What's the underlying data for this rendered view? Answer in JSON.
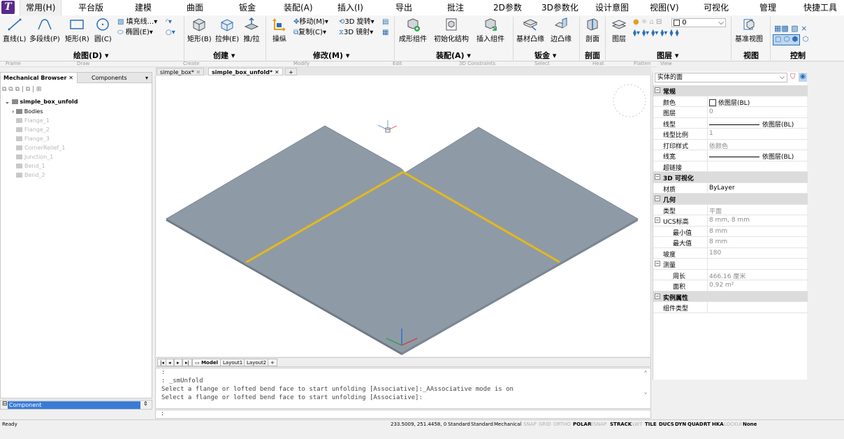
{
  "menu": {
    "tabs": [
      {
        "label": "常用(H)",
        "active": true
      },
      {
        "label": "平台版"
      },
      {
        "label": "建模"
      },
      {
        "label": "曲面"
      },
      {
        "label": "钣金"
      },
      {
        "label": "装配(A)"
      },
      {
        "label": "插入(I)"
      },
      {
        "label": "导出"
      },
      {
        "label": "批注"
      },
      {
        "label": "2D参数"
      },
      {
        "label": "3D参数化"
      },
      {
        "label": "设计意图"
      },
      {
        "label": "视图(V)"
      },
      {
        "label": "可视化"
      },
      {
        "label": "管理"
      },
      {
        "label": "快捷工具"
      }
    ]
  },
  "ribbon": {
    "draw": {
      "line": "直线(L)",
      "polyline": "多段线(P)",
      "rect": "矩形(R)",
      "circle": "圆(C)",
      "hatch": "填充线...",
      "ellipse": "椭圆(E)",
      "group": "绘图(D)"
    },
    "create": {
      "rect": "矩形(B)",
      "extrude": "拉伸(E)",
      "pushpull": "推/拉",
      "group": "创建"
    },
    "modify": {
      "manipulate": "操纵",
      "move": "移动(M)",
      "copy": "复制(C)",
      "rotate3d": "3D 旋转",
      "mirror3d": "3D 镜射",
      "group": "修改(M)"
    },
    "assembly": {
      "form": "成形组件",
      "init": "初始化结构",
      "insert": "插入组件",
      "group": "装配(A)"
    },
    "sheetmetal": {
      "base": "基材凸缘",
      "edge": "边凸缘",
      "group": "钣金"
    },
    "section": {
      "label": "剖面",
      "group": "剖面"
    },
    "layers": {
      "label": "图层",
      "layer_value": "0",
      "group": "图层"
    },
    "view": {
      "base": "基准视图",
      "group": "视图"
    },
    "control": {
      "group": "控制"
    },
    "faint_labels": [
      "Frame",
      "Draw",
      "Create",
      "Modify",
      "Edit",
      "3D Constraints",
      "Select",
      "Heat",
      "Flatten",
      "View"
    ]
  },
  "browser": {
    "tabs": [
      "Mechanical Browser",
      "Components"
    ],
    "root": "simple_box_unfold",
    "items": [
      {
        "label": "Bodies",
        "faded": false
      },
      {
        "label": "Flange_1",
        "faded": true
      },
      {
        "label": "Flange_2",
        "faded": true
      },
      {
        "label": "Flange_3",
        "faded": true
      },
      {
        "label": "CornerRelief_1",
        "faded": true
      },
      {
        "label": "Junction_1",
        "faded": true
      },
      {
        "label": "Bend_1",
        "faded": true
      },
      {
        "label": "Bend_2",
        "faded": true
      }
    ],
    "component_field": "Component"
  },
  "doc_tabs": [
    {
      "label": "simple_box*",
      "active": false
    },
    {
      "label": "simple_box_unfold*",
      "active": true
    }
  ],
  "layout_tabs": [
    {
      "label": "Model",
      "active": true
    },
    {
      "label": "Layout1",
      "active": false
    },
    {
      "label": "Layout2",
      "active": false
    }
  ],
  "command_line": {
    "lines": [
      ":",
      ": _smUnfold",
      "Select a flange or lofted bend face to start unfolding [Associative]:_AAssociative mode is on",
      "Select a flange or lofted bend face to start unfolding [Associative]:"
    ],
    "prompt": ":"
  },
  "properties": {
    "selection": "实体的面",
    "rows": [
      {
        "type": "cat",
        "key": "常规"
      },
      {
        "key": "颜色",
        "value": "依图层(BL)",
        "swatch": true
      },
      {
        "key": "图层",
        "value": "0",
        "grey": true
      },
      {
        "key": "线型",
        "value": "依图层(BL)",
        "line": true
      },
      {
        "key": "线型比例",
        "value": "1",
        "grey": true
      },
      {
        "key": "打印样式",
        "value": "依颜色",
        "grey": true
      },
      {
        "key": "线宽",
        "value": "依图层(BL)",
        "line": true
      },
      {
        "key": "超链接",
        "value": ""
      },
      {
        "type": "cat",
        "key": "3D 可视化"
      },
      {
        "key": "材质",
        "value": "ByLayer"
      },
      {
        "type": "cat",
        "key": "几何"
      },
      {
        "key": "类型",
        "value": "平面",
        "grey": true
      },
      {
        "key": "UCS标高",
        "value": "8 mm, 8 mm",
        "grey": true,
        "expander": true
      },
      {
        "key": "最小值",
        "value": "8 mm",
        "grey": true,
        "sub": true
      },
      {
        "key": "最大值",
        "value": "8 mm",
        "grey": true,
        "sub": true
      },
      {
        "key": "坡度",
        "value": "180",
        "grey": true
      },
      {
        "key": "测量",
        "value": "",
        "expander": true
      },
      {
        "key": "周长",
        "value": "466.16 厘米",
        "grey": true,
        "sub": true
      },
      {
        "key": "面积",
        "value": "0.92 m²",
        "grey": true,
        "sub": true
      },
      {
        "type": "cat",
        "key": "实例属性"
      },
      {
        "key": "组件类型",
        "value": ""
      }
    ]
  },
  "status": {
    "ready": "Ready",
    "coords": "233.5009, 251.4458, 0",
    "items": [
      {
        "label": "Standard",
        "on": false,
        "plain": true
      },
      {
        "label": "Standard",
        "on": false,
        "plain": true
      },
      {
        "label": "Mechanical",
        "on": false,
        "plain": true
      },
      {
        "label": "SNAP",
        "on": false
      },
      {
        "label": "GRID",
        "on": false
      },
      {
        "label": "ORTHO",
        "on": false
      },
      {
        "label": "POLAR",
        "on": true
      },
      {
        "label": "ESNAP",
        "on": false
      },
      {
        "label": "STRACK",
        "on": true
      },
      {
        "label": "LWT",
        "on": false
      },
      {
        "label": "TILE",
        "on": true
      },
      {
        "label": "DUCS",
        "on": true
      },
      {
        "label": "DYN",
        "on": true
      },
      {
        "label": "QUAD",
        "on": true
      },
      {
        "label": "RT",
        "on": true
      },
      {
        "label": "HKA",
        "on": true
      },
      {
        "label": "LOCKUI",
        "on": false
      },
      {
        "label": "None",
        "on": true
      }
    ]
  },
  "colors": {
    "sheet_fill": "#8e9ba6",
    "bend_line": "#e5b81c",
    "selection": "#3a7bd5",
    "logo": "#5a2a8a"
  }
}
